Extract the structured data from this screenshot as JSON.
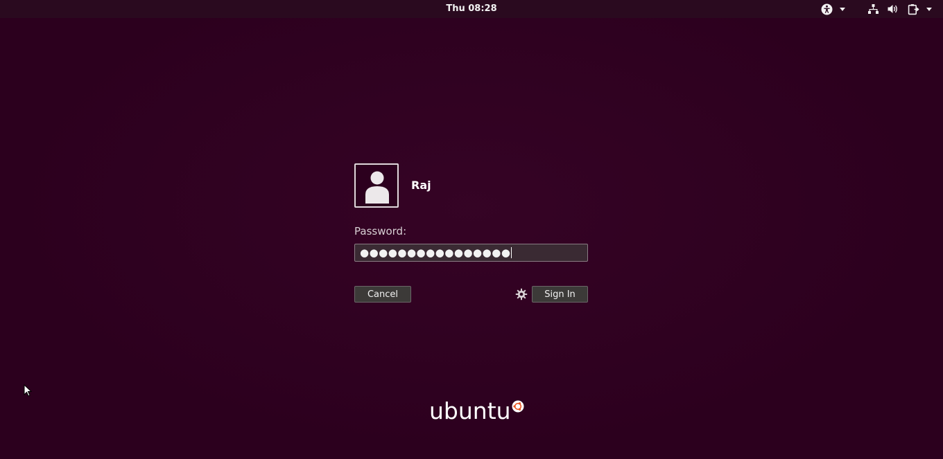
{
  "topbar": {
    "clock": "Thu 08:28",
    "icons": [
      "accessibility-icon",
      "network-icon",
      "volume-icon",
      "power-icon"
    ]
  },
  "login": {
    "username": "Raj",
    "password_label": "Password:",
    "password_value": "●●●●●●●●●●●●●●●●",
    "cancel_label": "Cancel",
    "signin_label": "Sign In",
    "session_icon": "gear-icon"
  },
  "brand": {
    "logo_text": "ubuntu"
  },
  "colors": {
    "background": "#2c001e",
    "topbar": "#2a0a1f",
    "button": "#3c3a38",
    "field": "#3a2a33"
  }
}
